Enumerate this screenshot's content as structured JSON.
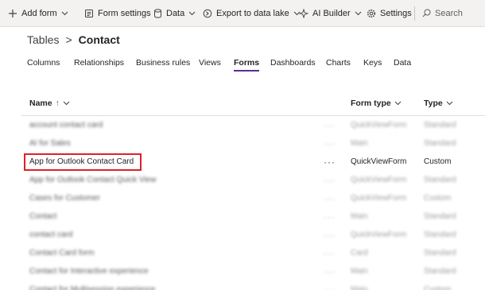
{
  "commandbar": {
    "add_form": "Add form",
    "form_settings": "Form settings",
    "data": "Data",
    "export": "Export to data lake",
    "ai_builder": "AI Builder",
    "settings": "Settings",
    "search": "Search"
  },
  "breadcrumb": {
    "root": "Tables",
    "separator": ">",
    "current": "Contact"
  },
  "tabs": [
    {
      "label": "Columns"
    },
    {
      "label": "Relationships"
    },
    {
      "label": "Business rules"
    },
    {
      "label": "Views"
    },
    {
      "label": "Forms",
      "active": true
    },
    {
      "label": "Dashboards"
    },
    {
      "label": "Charts"
    },
    {
      "label": "Keys"
    },
    {
      "label": "Data"
    }
  ],
  "grid": {
    "columns": {
      "name": "Name",
      "form_type": "Form type",
      "type": "Type"
    },
    "sort_indicator": "↑",
    "more_label": "···",
    "rows": [
      {
        "name": "account contact card",
        "form_type": "QuickViewForm",
        "type": "Standard",
        "blurred": true
      },
      {
        "name": "AI for Sales",
        "form_type": "Main",
        "type": "Standard",
        "blurred": true
      },
      {
        "name": "App for Outlook Contact Card",
        "form_type": "QuickViewForm",
        "type": "Custom",
        "blurred": false
      },
      {
        "name": "App for Outlook Contact Quick View",
        "form_type": "QuickViewForm",
        "type": "Standard",
        "blurred": true
      },
      {
        "name": "Cases for Customer",
        "form_type": "QuickViewForm",
        "type": "Custom",
        "blurred": true
      },
      {
        "name": "Contact",
        "form_type": "Main",
        "type": "Standard",
        "blurred": true
      },
      {
        "name": "contact card",
        "form_type": "QuickViewForm",
        "type": "Standard",
        "blurred": true
      },
      {
        "name": "Contact Card form",
        "form_type": "Card",
        "type": "Standard",
        "blurred": true
      },
      {
        "name": "Contact for Interactive experience",
        "form_type": "Main",
        "type": "Standard",
        "blurred": true
      },
      {
        "name": "Contact for Multisession experience",
        "form_type": "Main",
        "type": "Custom",
        "blurred": true
      }
    ]
  },
  "colors": {
    "accent": "#5c2d91",
    "highlight": "#e0202a",
    "commandbar_bg": "#f3f2f1"
  }
}
